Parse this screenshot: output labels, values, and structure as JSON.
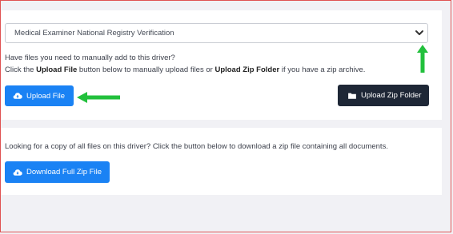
{
  "select": {
    "value": "Medical Examiner National Registry Verification"
  },
  "upload_section": {
    "line1": "Have files you need to manually add to this driver?",
    "line2_prefix": "Click the ",
    "line2_bold1": "Upload File",
    "line2_middle": " button below to manually upload files or ",
    "line2_bold2": "Upload Zip Folder",
    "line2_suffix": " if you have a zip archive.",
    "upload_file_label": "Upload File",
    "upload_zip_label": "Upload Zip Folder"
  },
  "download_section": {
    "text": "Looking for a copy of all files on this driver? Click the button below to download a zip file containing all documents.",
    "download_label": "Download Full Zip File"
  },
  "icons": {
    "chevron": "chevron-down-icon",
    "upload": "cloud-upload-icon",
    "folder": "folder-icon",
    "download": "cloud-download-icon",
    "annotation_arrows": "green-arrow-icon"
  },
  "colors": {
    "primary": "#1a82f4",
    "dark": "#1e2736",
    "annotation": "#22c03c"
  }
}
